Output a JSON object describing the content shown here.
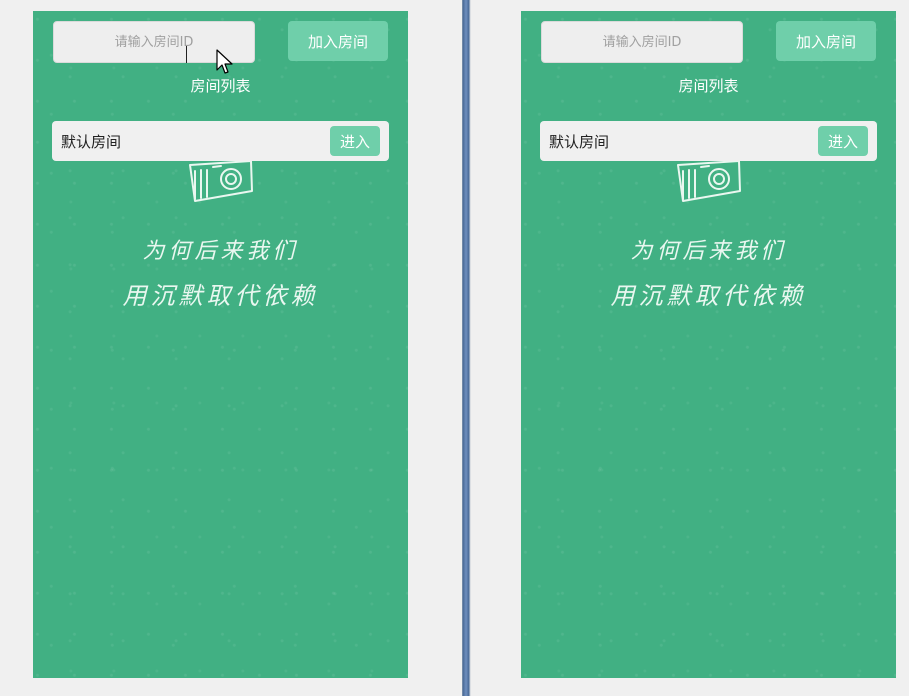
{
  "windows": [
    {
      "search": {
        "placeholder": "请输入房间ID"
      },
      "join_button": "加入房间",
      "list_title": "房间列表",
      "rooms": [
        {
          "name": "默认房间",
          "enter_label": "进入"
        }
      ],
      "slogan": {
        "line1": "为何后来我们",
        "line2": "用沉默取代依赖"
      }
    },
    {
      "search": {
        "placeholder": "请输入房间ID"
      },
      "join_button": "加入房间",
      "list_title": "房间列表",
      "rooms": [
        {
          "name": "默认房间",
          "enter_label": "进入"
        }
      ],
      "slogan": {
        "line1": "为何后来我们",
        "line2": "用沉默取代依赖"
      }
    }
  ],
  "colors": {
    "background_green": "#41b083",
    "button_green": "#6fcfaa",
    "input_background": "#eeeeee",
    "card_background": "#f0f0f0"
  },
  "icons": [
    "camera-icon",
    "mouse-cursor-icon"
  ]
}
